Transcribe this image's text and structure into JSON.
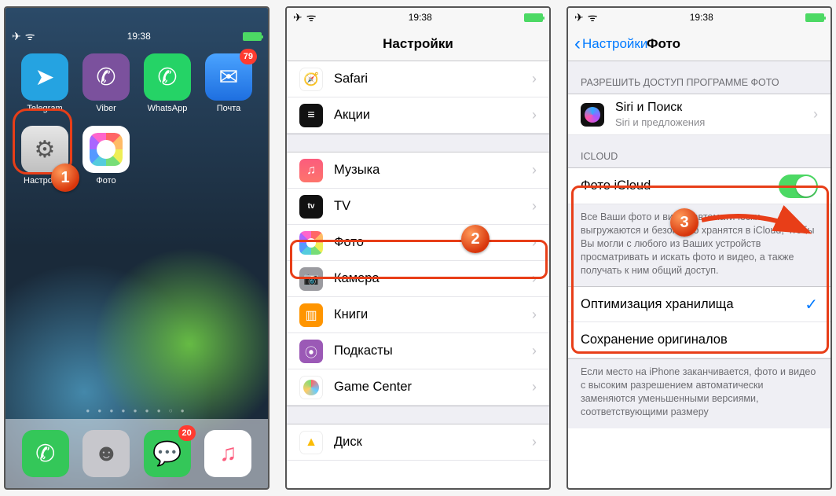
{
  "status": {
    "time": "19:38"
  },
  "home": {
    "apps": [
      {
        "name": "Telegram",
        "bg": "#25a3e1",
        "glyph": "➤",
        "badge": null
      },
      {
        "name": "Viber",
        "bg": "#7b519d",
        "glyph": "✆",
        "badge": null
      },
      {
        "name": "WhatsApp",
        "bg": "#25d366",
        "glyph": "✆",
        "badge": null
      },
      {
        "name": "Почта",
        "bg": "#1e90ff",
        "glyph": "✉",
        "badge": "79"
      },
      {
        "name": "Настройки",
        "bg": "linear-gradient(#e6e6e6,#bfbfbf)",
        "glyph": "⚙",
        "badge": null,
        "glyphColor": "#555"
      },
      {
        "name": "Фото",
        "bg": "#ffffff",
        "glyph": "photos",
        "badge": null
      }
    ],
    "dock": [
      {
        "name": "Телефон",
        "bg": "#34c759",
        "glyph": "✆"
      },
      {
        "name": "Контакты",
        "bg": "#a8a8ad",
        "glyph": "👤"
      },
      {
        "name": "Сообщения",
        "bg": "#34c759",
        "glyph": "💬",
        "badge": "20"
      },
      {
        "name": "Музыка",
        "bg": "linear-gradient(#fc5c7d,#fd746c)",
        "glyph": "♫"
      }
    ]
  },
  "settings": {
    "title": "Настройки",
    "group1": [
      {
        "label": "Safari",
        "bg": "#ffffff",
        "glyph": "🧭",
        "glyphColor": "#1e90ff"
      },
      {
        "label": "Акции",
        "bg": "#111111",
        "glyph": "≋"
      }
    ],
    "group2": [
      {
        "label": "Музыка",
        "bg": "linear-gradient(#fc5c7d,#fd746c)",
        "glyph": "♫"
      },
      {
        "label": "TV",
        "bg": "#111111",
        "glyph": "⊟",
        "prefix": "tv"
      },
      {
        "label": "Фото",
        "bg": "photos"
      },
      {
        "label": "Камера",
        "bg": "#9b9ba0",
        "glyph": "📷"
      },
      {
        "label": "Книги",
        "bg": "#ff9500",
        "glyph": "▥"
      },
      {
        "label": "Подкасты",
        "bg": "#9b59b6",
        "glyph": "⦿"
      },
      {
        "label": "Game Center",
        "bg": "#ffffff",
        "glyph": "✦",
        "glyphColor": "#34c759"
      }
    ],
    "group3": [
      {
        "label": "Диск",
        "bg": "#ffffff",
        "glyph": "▲",
        "glyphColor": "#fbbc05"
      }
    ]
  },
  "photoSettings": {
    "back": "Настройки",
    "title": "Фото",
    "sectionAllow": "РАЗРЕШИТЬ ДОСТУП ПРОГРАММЕ ФОТО",
    "siri": {
      "title": "Siri и Поиск",
      "subtitle": "Siri и предложения"
    },
    "sectionICloud": "ICLOUD",
    "icloudPhoto": "Фото iCloud",
    "icloudDesc": "Все Ваши фото и видео автоматически выгружаются и безопасно хранятся в iCloud, чтобы Вы могли с любого из Ваших устройств просматривать и искать фото и видео, а также получать к ним общий доступ.",
    "optimize": "Оптимизация хранилища",
    "keepOriginals": "Сохранение оригиналов",
    "bottomDesc": "Если место на iPhone заканчивается, фото и видео с высоким разрешением автоматически заменяются уменьшенными версиями, соответствующими размеру"
  },
  "markers": {
    "1": "1",
    "2": "2",
    "3": "3"
  }
}
